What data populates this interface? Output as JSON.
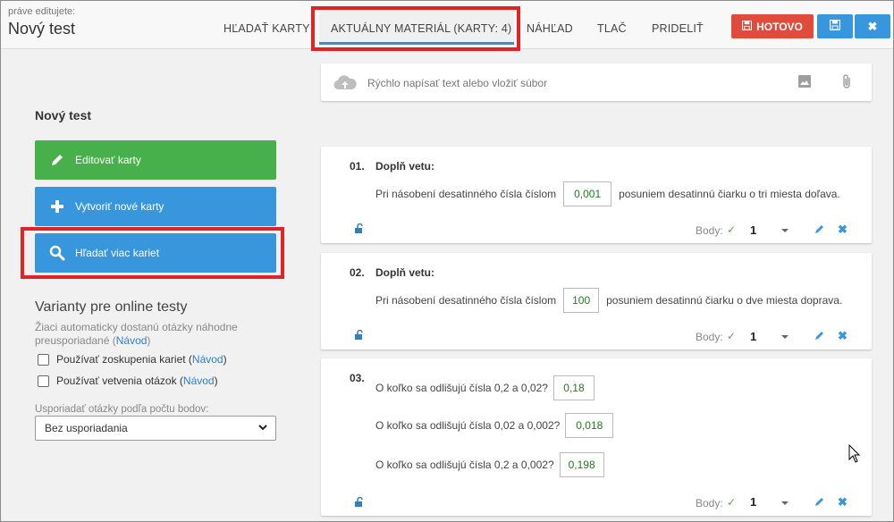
{
  "header": {
    "edit_label": "práve editujete:",
    "title": "Nový test",
    "tabs": {
      "search": "HĽADAŤ KARTY",
      "current": "AKTUÁLNY MATERIÁL (KARTY: 4)",
      "preview": "NÁHĽAD",
      "print": "TLAČ",
      "assign": "PRIDELIŤ"
    },
    "done_label": "HOTOVO"
  },
  "sidebar": {
    "title": "Nový test",
    "edit_cards": "Editovať karty",
    "new_cards": "Vytvoriť nové karty",
    "find_cards": "Hľadať viac kariet",
    "variants_title": "Varianty pre online testy",
    "variants_desc": "Žiaci automaticky dostanú otázky náhodne preusporiadané (",
    "guide_link": "Návod",
    "variants_desc_end": ")",
    "option_groups": "Používať zoskupenia kariet (",
    "option_branch": "Používať vetvenia otázok (",
    "paren_close": ")",
    "sort_label": "Usporiadať otázky podľa počtu bodov:",
    "sort_value": "Bez usporiadania"
  },
  "quick": {
    "placeholder": "Rýchlo napísať text alebo vložiť súbor"
  },
  "cards": [
    {
      "number": "01.",
      "title": "Doplň vetu:",
      "before": "Pri násobení desatinného čísla číslom",
      "answer": "0,001",
      "after": "posuniem desatinnú čiarku o tri miesta doľava.",
      "points_label": "Body:",
      "points": "1"
    },
    {
      "number": "02.",
      "title": "Doplň vetu:",
      "before": "Pri násobení desatinného čísla číslom",
      "answer": "100",
      "after": "posuniem desatinnú čiarku o dve miesta doprava.",
      "points_label": "Body:",
      "points": "1"
    },
    {
      "number": "03.",
      "q1": "O koľko sa odlišujú čísla 0,2 a 0,02?",
      "a1": "0,18",
      "q2": "O koľko sa odlišujú čísla 0,02 a 0,002?",
      "a2": "0,018",
      "q3": "O koľko sa odlišujú čísla 0,2 a 0,002?",
      "a3": "0,198",
      "points_label": "Body:",
      "points": "1"
    }
  ],
  "colors": {
    "accent": "#3896dc",
    "done": "#e04b3d",
    "edit": "#47b04b",
    "highlight": "#e02323"
  }
}
